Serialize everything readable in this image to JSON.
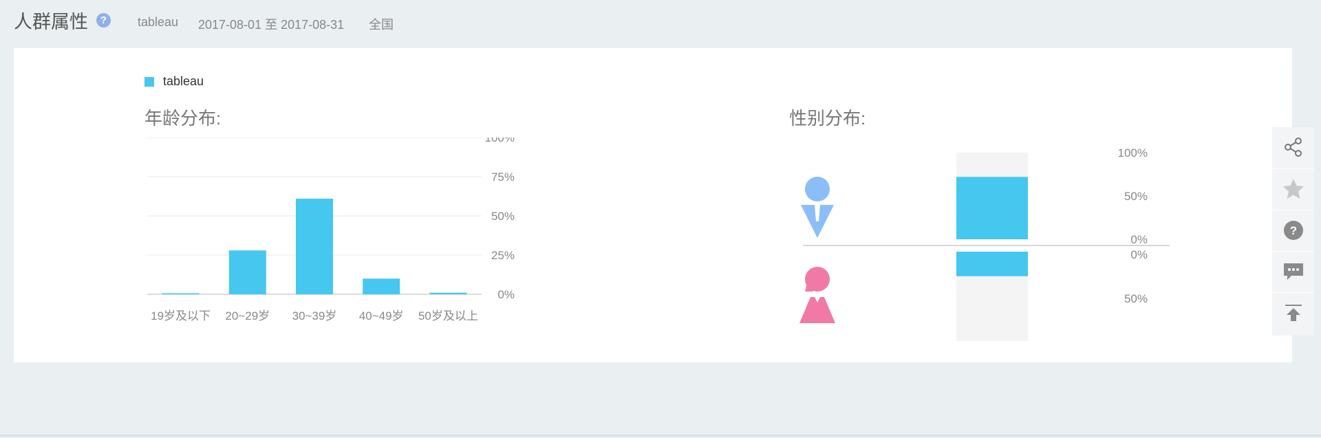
{
  "header": {
    "title": "人群属性",
    "keyword": "tableau",
    "date_range": "2017-08-01 至 2017-08-31",
    "region": "全国"
  },
  "legend": {
    "label": "tableau",
    "color": "#46c7f0"
  },
  "colors": {
    "bar": "#46c7f0",
    "male": "#8bbdf9",
    "female": "#f07aa5",
    "track": "#f4f4f4"
  },
  "age": {
    "title": "年龄分布:"
  },
  "gender": {
    "title": "性别分布:"
  },
  "chart_data": [
    {
      "type": "bar",
      "title": "年龄分布:",
      "categories": [
        "19岁及以下",
        "20~29岁",
        "30~39岁",
        "40~49岁",
        "50岁及以上"
      ],
      "values": [
        0.5,
        28,
        61,
        10,
        1
      ],
      "yticks": [
        "100%",
        "75%",
        "50%",
        "25%",
        "0%"
      ],
      "ylim": [
        0,
        100
      ],
      "grid": true
    },
    {
      "type": "bar",
      "title": "性别分布:",
      "categories": [
        "男",
        "女"
      ],
      "values": [
        72,
        28
      ],
      "male_ticks": [
        "100%",
        "50%",
        "0%"
      ],
      "female_ticks": [
        "0%",
        "50%"
      ],
      "ylim": [
        0,
        100
      ]
    }
  ],
  "toolbar": [
    "share-icon",
    "star-icon",
    "help-icon",
    "comment-icon",
    "back-to-top-icon"
  ]
}
